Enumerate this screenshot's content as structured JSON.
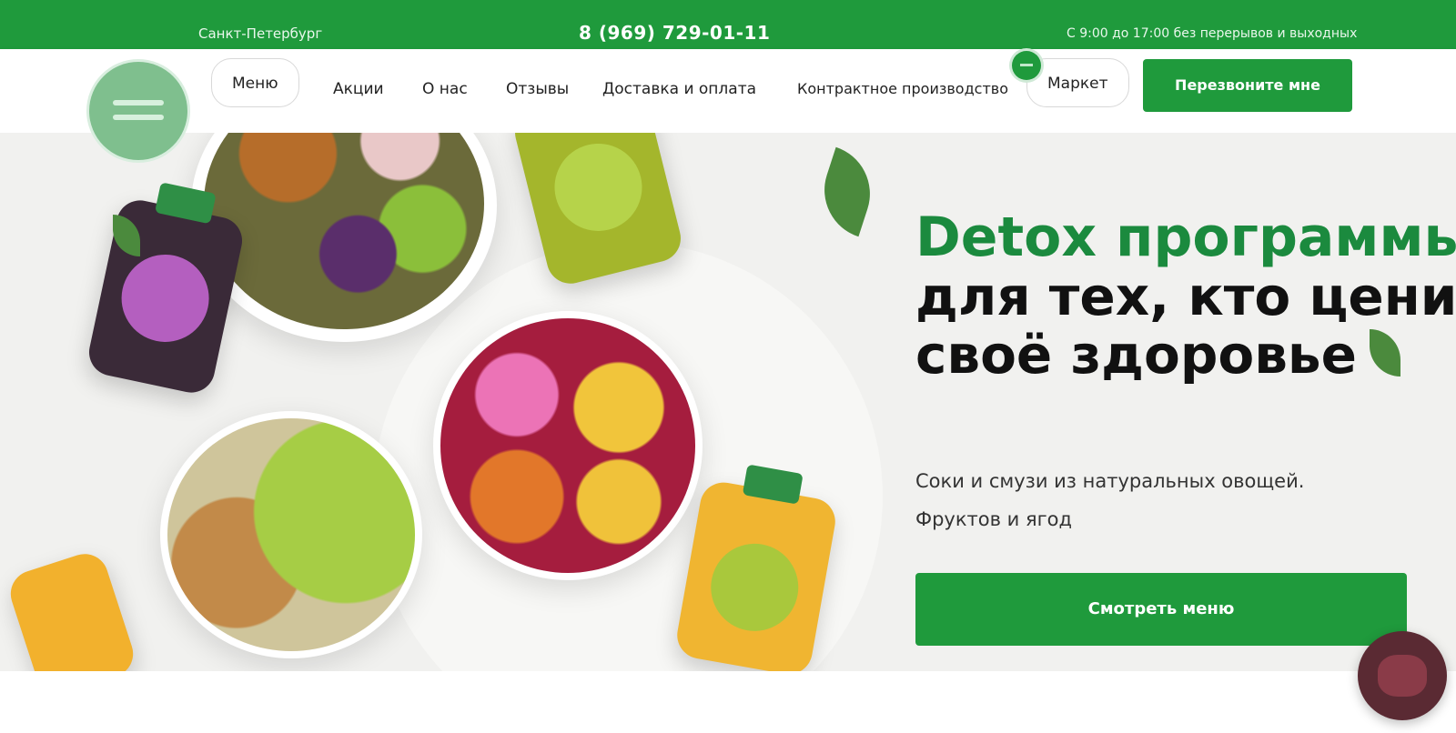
{
  "topbar": {
    "city": "Санкт-Петербург",
    "phone": "8 (969) 729-01-11",
    "hours": "С 9:00 до 17:00 без перерывов и выходных"
  },
  "nav": {
    "items": [
      "Меню",
      "Акции",
      "О нас",
      "Отзывы",
      "Доставка и оплата",
      "Контрактное производство",
      "Маркет"
    ],
    "callback_label": "Перезвоните мне"
  },
  "hero": {
    "title_line1": "Detox программы",
    "title_line2": "для тех, кто ценит",
    "title_line3": "своё здоровье",
    "subtitle": "Соки и смузи из натуральных овощей. Фруктов и ягод",
    "cta_label": "Смотреть меню"
  },
  "colors": {
    "brand_green": "#1f9a3c",
    "title_green": "#1b8a3e",
    "hero_background": "#f1f1ef"
  },
  "icons": [
    "logo-icon",
    "leaf-icon",
    "chat-avatar-icon",
    "market-badge-icon"
  ]
}
